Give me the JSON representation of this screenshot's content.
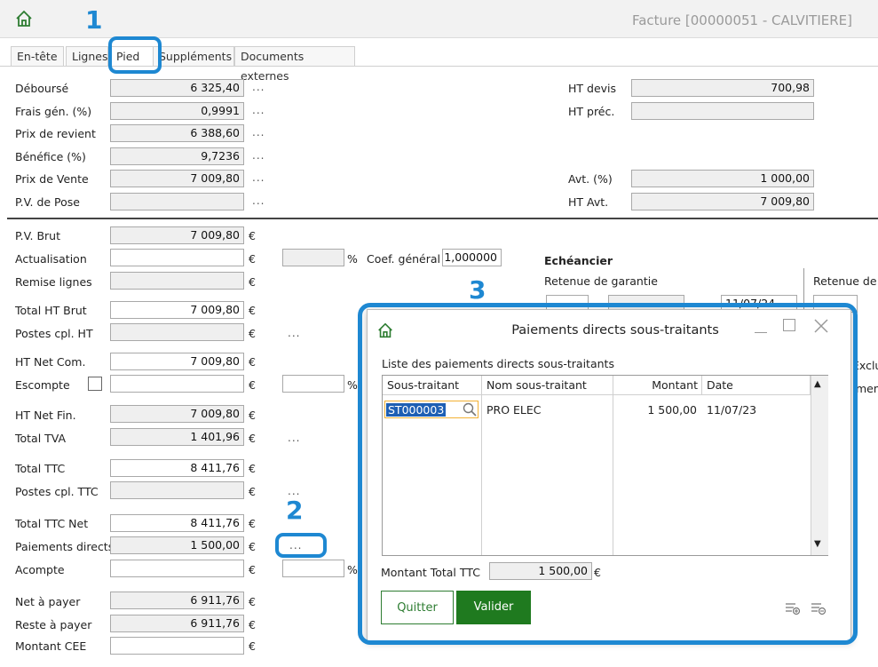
{
  "window": {
    "title": "Facture [00000051 - CALVITIERE]"
  },
  "tabs": [
    "En-tête",
    "Lignes",
    "Pied",
    "Suppléments",
    "Documents externes"
  ],
  "active_tab": "Pied",
  "annotations": [
    "1",
    "2",
    "3"
  ],
  "top_left": [
    {
      "label": "Déboursé",
      "value": "6 325,40"
    },
    {
      "label": "Frais gén. (%)",
      "value": "0,9991"
    },
    {
      "label": "Prix de revient",
      "value": "6 388,60"
    },
    {
      "label": "Bénéfice (%)",
      "value": "9,7236"
    },
    {
      "label": "Prix de Vente",
      "value": "7 009,80"
    },
    {
      "label": "P.V. de Pose",
      "value": ""
    }
  ],
  "top_right": [
    {
      "label": "HT devis",
      "value": "700,98"
    },
    {
      "label": "HT préc.",
      "value": ""
    },
    {
      "label": "Avt. (%)",
      "value": "1 000,00"
    },
    {
      "label": "HT Avt.",
      "value": "7 009,80"
    }
  ],
  "bottom_left": [
    {
      "label": "P.V. Brut",
      "value": "7 009,80"
    },
    {
      "label": "Actualisation",
      "value": ""
    },
    {
      "label": "Remise lignes",
      "value": ""
    },
    {
      "label": "Total HT Brut",
      "value": "7 009,80"
    },
    {
      "label": "Postes cpl. HT",
      "value": ""
    },
    {
      "label": "HT Net Com.",
      "value": "7 009,80"
    },
    {
      "label": "Escompte",
      "value": ""
    },
    {
      "label": "HT Net Fin.",
      "value": "7 009,80"
    },
    {
      "label": "Total TVA",
      "value": "1 401,96"
    },
    {
      "label": "Total TTC",
      "value": "8 411,76"
    },
    {
      "label": "Postes cpl. TTC",
      "value": ""
    },
    {
      "label": "Total TTC Net",
      "value": "8 411,76"
    },
    {
      "label": "Paiements directs",
      "value": "1 500,00"
    },
    {
      "label": "Acompte",
      "value": ""
    },
    {
      "label": "Net à payer",
      "value": "6 911,76"
    },
    {
      "label": "Reste à payer",
      "value": "6 911,76"
    },
    {
      "label": "Montant CEE",
      "value": ""
    }
  ],
  "symbols": {
    "euro": "€",
    "percent": "%",
    "dots": "..."
  },
  "coef": {
    "label": "Coef. général",
    "value": "1,000000"
  },
  "echeancier": {
    "title": "Echéancier",
    "retenue_label": "Retenue de garantie",
    "date_value": "11/07/24",
    "retenue_right_label": "Retenue de",
    "excl_label": "Exclu",
    "paiement_partial": "ment"
  },
  "dialog": {
    "title": "Paiements directs sous-traitants",
    "list_label": "Liste des paiements directs sous-traitants",
    "columns": [
      "Sous-traitant",
      "Nom sous-traitant",
      "Montant",
      "Date"
    ],
    "rows": [
      {
        "code": "ST000003",
        "name": "PRO ELEC",
        "amount": "1 500,00",
        "date": "11/07/23"
      }
    ],
    "total_label": "Montant Total TTC",
    "total_value": "1 500,00",
    "quit_label": "Quitter",
    "validate_label": "Valider"
  },
  "colors": {
    "accent_blue": "#1e88d2",
    "green": "#2e7d32",
    "green_button": "#1f7a1f"
  }
}
